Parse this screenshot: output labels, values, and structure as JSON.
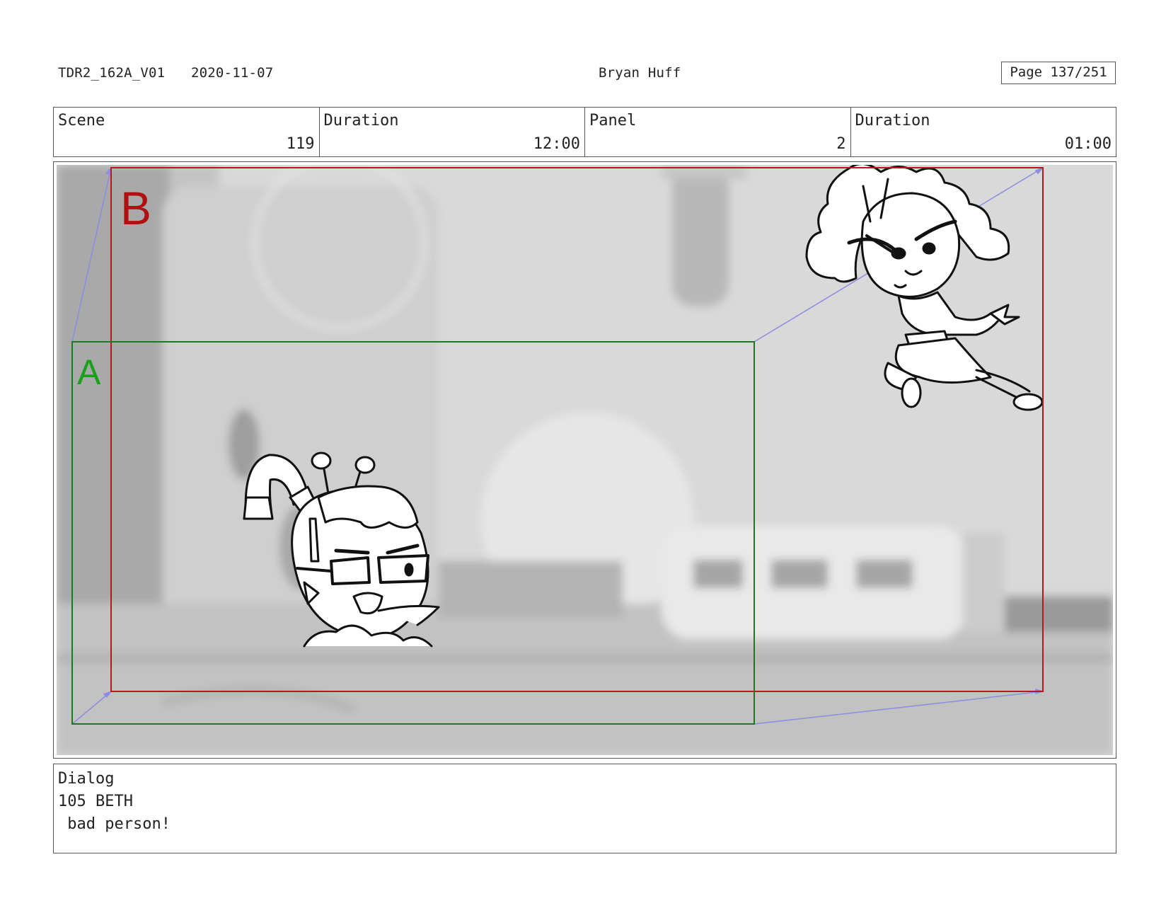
{
  "header": {
    "production_code": "TDR2_162A_V01",
    "date": "2020-11-07",
    "artist": "Bryan Huff",
    "page": "Page 137/251"
  },
  "info": {
    "scene_label": "Scene",
    "scene_value": "119",
    "scene_duration_label": "Duration",
    "scene_duration_value": "12:00",
    "panel_label": "Panel",
    "panel_value": "2",
    "panel_duration_label": "Duration",
    "panel_duration_value": "01:00"
  },
  "panel": {
    "camera_frames": [
      {
        "label": "A",
        "color": "#1aa01a"
      },
      {
        "label": "B",
        "color": "#b01010"
      }
    ],
    "move_arrow_color": "#8c8ce0",
    "characters": [
      "boy-with-glasses",
      "girl-with-curly-hair"
    ]
  },
  "dialog": {
    "title": "Dialog",
    "speaker": "105 BETH",
    "line": " bad person!"
  }
}
